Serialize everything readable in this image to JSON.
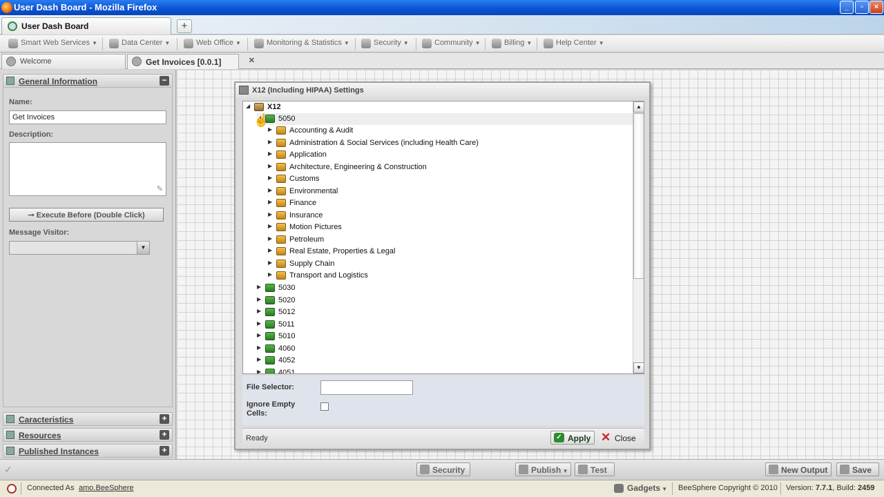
{
  "window": {
    "title": "User Dash Board - Mozilla Firefox"
  },
  "browser_tabs": {
    "active": "User Dash Board",
    "new_tab": "+"
  },
  "menu": [
    {
      "label": "Smart Web Services",
      "icon": "services-icon"
    },
    {
      "label": "Data Center",
      "icon": "data-center-icon"
    },
    {
      "label": "Web Office",
      "icon": "web-office-icon"
    },
    {
      "label": "Monitoring & Statistics",
      "icon": "monitoring-icon"
    },
    {
      "label": "Security",
      "icon": "security-icon"
    },
    {
      "label": "Community",
      "icon": "community-icon"
    },
    {
      "label": "Billing",
      "icon": "billing-icon"
    },
    {
      "label": "Help Center",
      "icon": "help-icon"
    }
  ],
  "doc_tabs": [
    {
      "label": "Welcome"
    },
    {
      "label": "Get Invoices [0.0.1]"
    }
  ],
  "left_panel": {
    "general_title": "General Information",
    "name_label": "Name:",
    "name_value": "Get Invoices",
    "description_label": "Description:",
    "execute_button": "Execute Before (Double Click)",
    "message_visitor_label": "Message Visitor:",
    "sections": [
      "Caracteristics",
      "Resources",
      "Published Instances"
    ]
  },
  "dialog": {
    "title": "X12 (Including HIPAA) Settings",
    "tree": {
      "root": "X12",
      "expanded_version": "5050",
      "categories": [
        "Accounting & Audit",
        "Administration & Social Services (including Health Care)",
        "Application",
        "Architecture, Engineering & Construction",
        "Customs",
        "Environmental",
        "Finance",
        "Insurance",
        "Motion Pictures",
        "Petroleum",
        "Real Estate, Properties & Legal",
        "Supply Chain",
        "Transport and Logistics"
      ],
      "versions": [
        "5030",
        "5020",
        "5012",
        "5011",
        "5010",
        "4060",
        "4052",
        "4051"
      ]
    },
    "file_selector_label": "File Selector:",
    "file_selector_value": "",
    "ignore_empty_label_1": "Ignore Empty",
    "ignore_empty_label_2": "Cells:",
    "status": "Ready",
    "apply": "Apply",
    "close": "Close"
  },
  "bottom_bar": {
    "security": "Security",
    "publish": "Publish",
    "test": "Test",
    "new_output": "New Output",
    "save": "Save"
  },
  "status_bar": {
    "connected_as": "Connected As",
    "user": "amo.BeeSphere",
    "gadgets": "Gadgets",
    "copyright": "BeeSphere Copyright © 2010",
    "version_prefix": "Version:",
    "version": "7.7.1",
    "build_prefix": "Build:",
    "build": "2459"
  },
  "colors": {
    "title_blue": "#0a52d4",
    "dialog_form_bg": "#dfe4ec",
    "apply_green": "#2f8a2f",
    "close_red": "#cc2222"
  }
}
